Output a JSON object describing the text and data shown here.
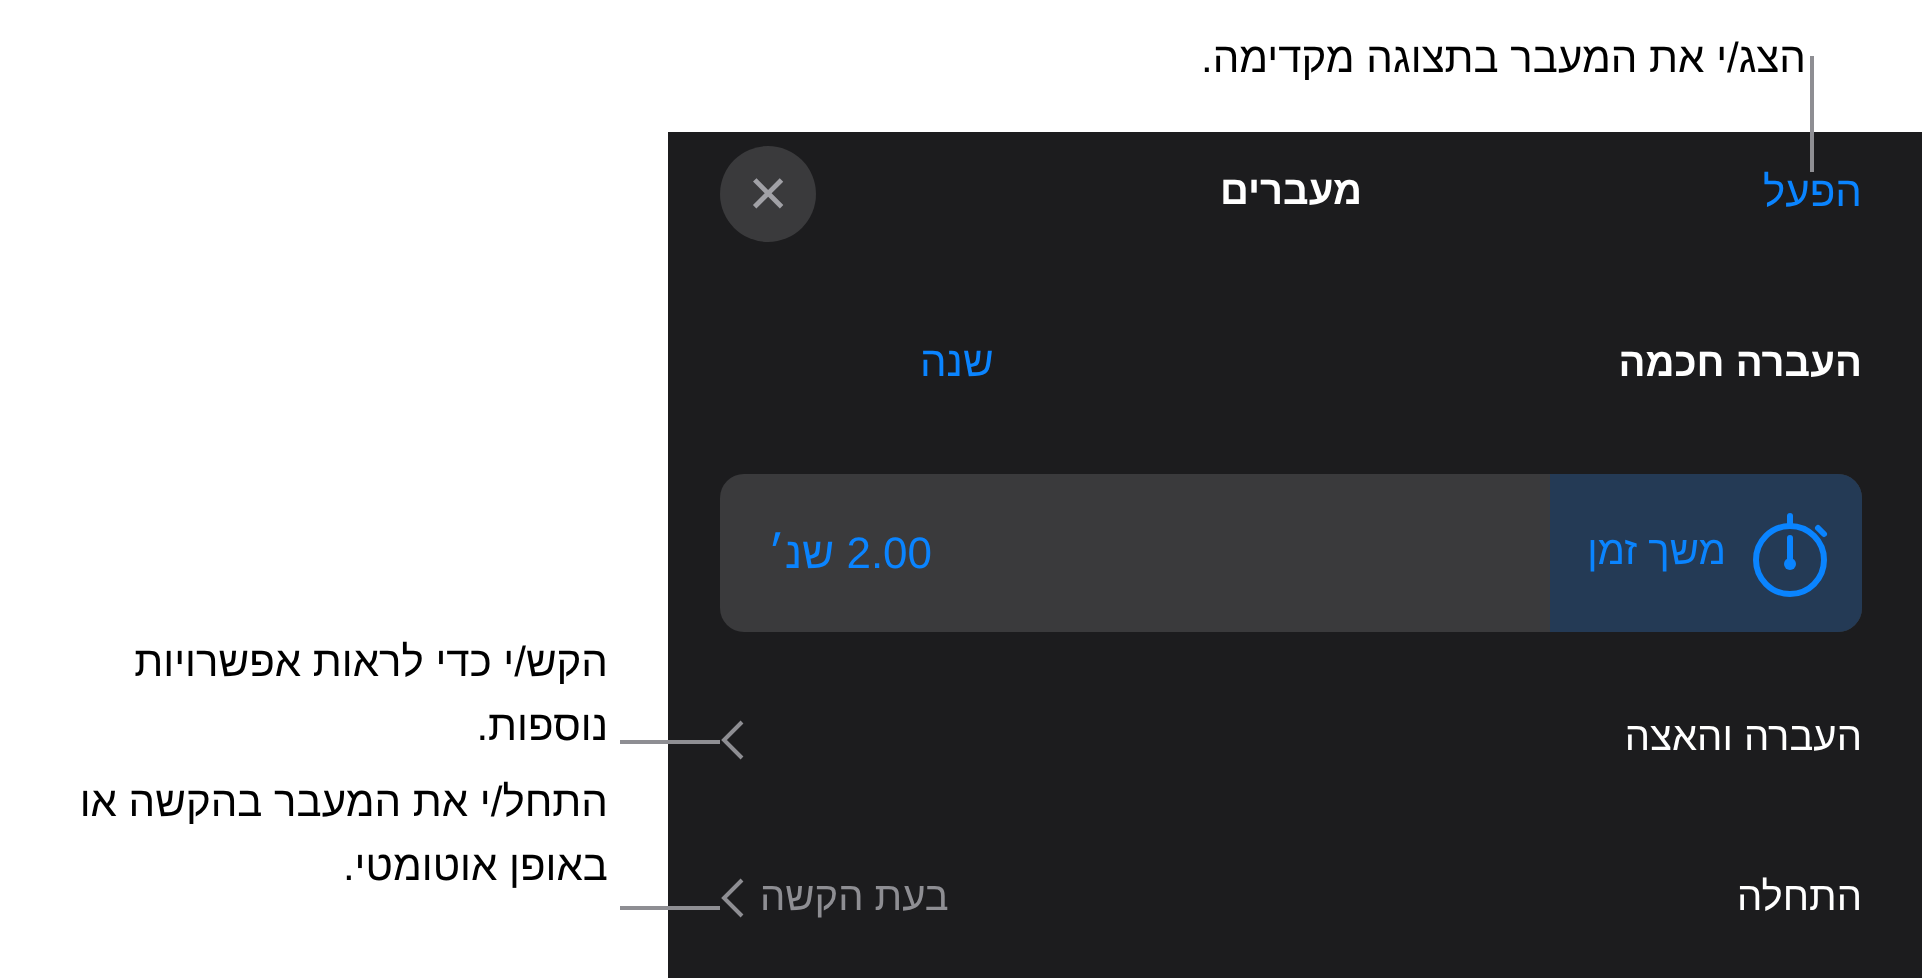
{
  "callouts": [
    {
      "text": "הצג/י את המעבר בתצוגה מקדימה."
    },
    {
      "text": "הקש/י כדי לראות אפשרויות נוספות."
    },
    {
      "text": "התחל/י את המעבר בהקשה או באופן אוטומטי."
    }
  ],
  "panel": {
    "play_button": "הפעל",
    "title": "מעברים",
    "close_label": "×",
    "effect": {
      "name": "העברה חכמה",
      "change_button": "שנה"
    },
    "duration": {
      "label": "משך זמן",
      "value": "2.00 שנ׳",
      "selected": true
    },
    "rows": [
      {
        "label": "העברה והאצה"
      },
      {
        "label": "התחלה",
        "value": "בעת הקשה"
      }
    ]
  }
}
